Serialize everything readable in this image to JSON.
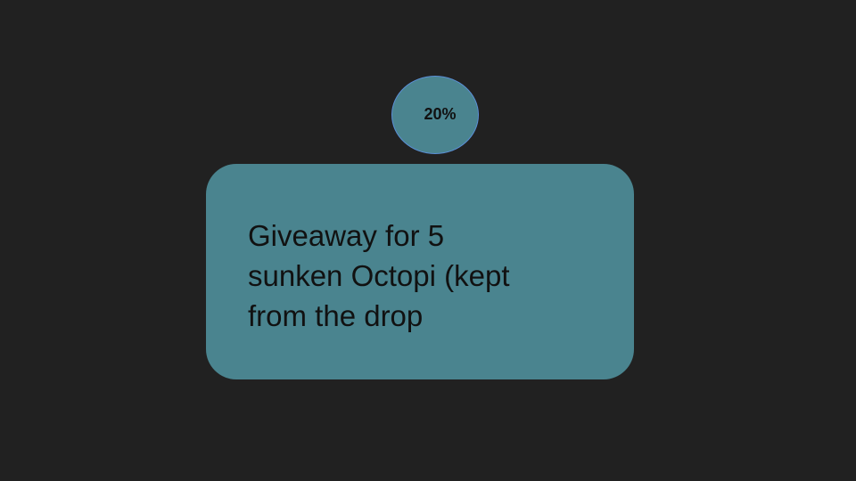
{
  "badge": {
    "label": "20%",
    "color": "#4a848f",
    "border_color": "#5a8fd6"
  },
  "card": {
    "text": "Giveaway for 5\nsunken Octopi (kept\nfrom the drop",
    "color": "#4a848f"
  },
  "colors": {
    "background": "#212121",
    "text": "#111111"
  }
}
